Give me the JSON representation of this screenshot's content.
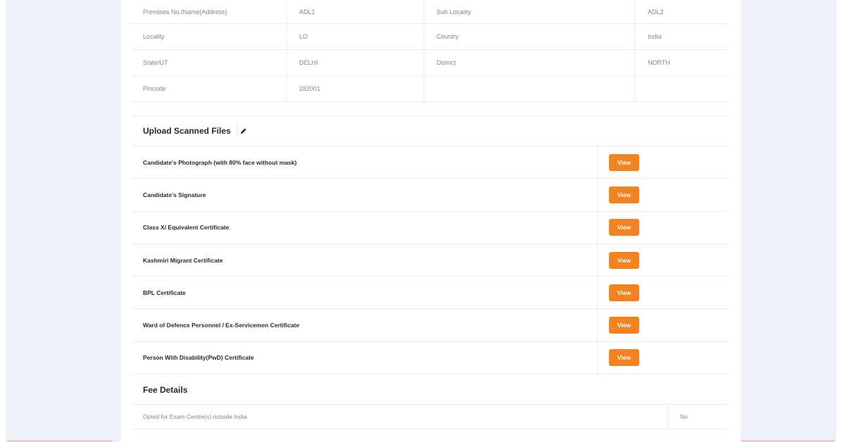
{
  "address_table": {
    "rows": [
      [
        "Premises No./Name(Address)",
        "ADL1",
        "Sub Locality",
        "ADL2"
      ],
      [
        "Locality",
        "LO",
        "Country",
        "India"
      ],
      [
        "State/UT",
        "DELHI",
        "District",
        "NORTH"
      ],
      [
        "Pincode",
        "282001",
        "",
        ""
      ]
    ]
  },
  "upload": {
    "title": "Upload Scanned Files",
    "edit_icon": "pencil-icon",
    "files": [
      {
        "label": "Candidate's Photograph (with 80% face without mask)",
        "button": "View"
      },
      {
        "label": "Candidate's Signature",
        "button": "View"
      },
      {
        "label": "Class X/ Equivalent Certificate",
        "button": "View"
      },
      {
        "label": "Kashmiri Migrant Certificate",
        "button": "View"
      },
      {
        "label": "BPL Certificate",
        "button": "View"
      },
      {
        "label": "Ward of Defence Personnel / Ex-Servicemen Certificate",
        "button": "View"
      },
      {
        "label": "Person With Disability(PwD) Certificate",
        "button": "View"
      }
    ]
  },
  "fee": {
    "title": "Fee Details",
    "rows": [
      {
        "label": "Opted for Exam Centre(s) outside India",
        "value": "No"
      }
    ]
  },
  "colors": {
    "accent": "#f58220",
    "background": "#eef1f8"
  }
}
